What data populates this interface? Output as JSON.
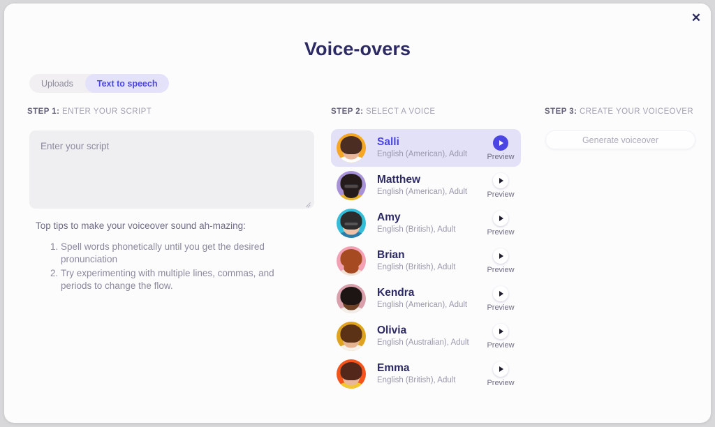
{
  "window": {
    "title": "Voice-overs",
    "close_icon": "close-icon",
    "close_glyph": "✕"
  },
  "tabs": [
    {
      "label": "Uploads",
      "active": false
    },
    {
      "label": "Text to speech",
      "active": true
    }
  ],
  "steps": {
    "step1": {
      "num": "STEP 1:",
      "text": " ENTER YOUR SCRIPT"
    },
    "step2": {
      "num": "STEP 2:",
      "text": " SELECT A VOICE"
    },
    "step3": {
      "num": "STEP 3:",
      "text": " CREATE YOUR VOICEOVER"
    }
  },
  "script": {
    "placeholder": "Enter your script",
    "value": ""
  },
  "tips": {
    "title": "Top tips to make your voiceover sound ah-mazing:",
    "items": [
      "Spell words phonetically until you get the desired pronunciation",
      "Try experimenting with multiple lines, commas, and periods to change the flow."
    ]
  },
  "voices": [
    {
      "name": "Salli",
      "lang": "English (American), Adult",
      "selected": true,
      "preview_label": "Preview",
      "avatar_bg": "#f5a623",
      "hair": "#4b2e21",
      "shoulders": "#ffffff",
      "skin": "#eab79b",
      "glasses": false,
      "beard": false
    },
    {
      "name": "Matthew",
      "lang": "English (American), Adult",
      "selected": false,
      "preview_label": "Preview",
      "avatar_bg": "#a893d8",
      "hair": "#241b1a",
      "shoulders": "#e8b12a",
      "skin": "#855636",
      "glasses": true,
      "beard": true
    },
    {
      "name": "Amy",
      "lang": "English (British), Adult",
      "selected": false,
      "preview_label": "Preview",
      "avatar_bg": "#35bcd8",
      "hair": "#2e2b2c",
      "shoulders": "#2c7ea8",
      "skin": "#eec2a8",
      "glasses": true,
      "beard": false
    },
    {
      "name": "Brian",
      "lang": "English (British), Adult",
      "selected": false,
      "preview_label": "Preview",
      "avatar_bg": "#f3a0b4",
      "hair": "#a64a22",
      "shoulders": "#f0e3d6",
      "skin": "#eeb896",
      "glasses": false,
      "beard": true
    },
    {
      "name": "Kendra",
      "lang": "English (American), Adult",
      "selected": false,
      "preview_label": "Preview",
      "avatar_bg": "#d9a0ac",
      "hair": "#1d1414",
      "shoulders": "#f3efe8",
      "skin": "#6e4226",
      "glasses": false,
      "beard": false
    },
    {
      "name": "Olivia",
      "lang": "English (Australian), Adult",
      "selected": false,
      "preview_label": "Preview",
      "avatar_bg": "#e0a320",
      "hair": "#5b3216",
      "shoulders": "#f6f1ea",
      "skin": "#e6b391",
      "glasses": false,
      "beard": false
    },
    {
      "name": "Emma",
      "lang": "English (British), Adult",
      "selected": false,
      "preview_label": "Preview",
      "avatar_bg": "#f2541b",
      "hair": "#53281a",
      "shoulders": "#f2c82e",
      "skin": "#eab79b",
      "glasses": false,
      "beard": false
    }
  ],
  "generate": {
    "label": "Generate voiceover",
    "disabled": true
  }
}
